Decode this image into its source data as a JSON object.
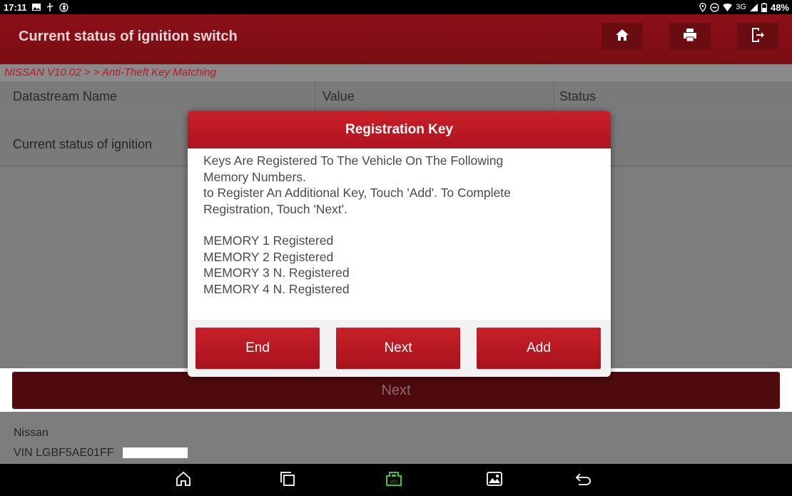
{
  "status_bar": {
    "time": "17:11",
    "battery": "48%",
    "network": "3G"
  },
  "header": {
    "title": "Current status of ignition switch",
    "buttons": [
      "home-icon",
      "print-icon",
      "exit-icon"
    ]
  },
  "breadcrumb": "NISSAN V10.02 > > Anti-Theft Key Matching",
  "table": {
    "columns": [
      "Datastream Name",
      "Value",
      "Status"
    ],
    "rows": [
      [
        "Current status of ignition",
        "",
        ""
      ]
    ]
  },
  "dialog": {
    "title": "Registration Key",
    "lines": [
      "Keys Are Registered To The Vehicle On The  Following",
      "Memory Numbers.",
      "to Register An Additional Key, Touch 'Add'. To Complete",
      "Registration, Touch 'Next'."
    ],
    "memory": [
      "MEMORY 1 Registered",
      "MEMORY 2 Registered",
      "MEMORY 3 N. Registered",
      "MEMORY 4 N. Registered"
    ],
    "buttons": {
      "end": "End",
      "next": "Next",
      "add": "Add"
    }
  },
  "bottom_button": "Next",
  "vehicle": {
    "make": "Nissan",
    "vin": "VIN LGBF5AE01FF"
  },
  "colors": {
    "brand_red": "#c8202a",
    "title_bar": "#8c1018"
  }
}
